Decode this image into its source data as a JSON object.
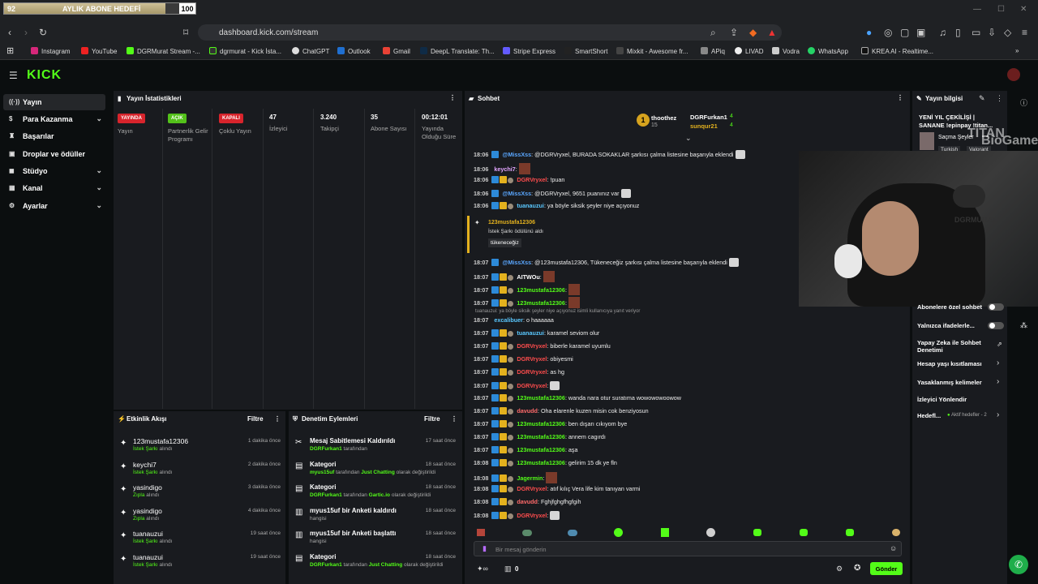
{
  "browser": {
    "goal_current": "92",
    "goal_label": "AYLIK ABONE HEDEFİ",
    "goal_total": "100",
    "goal_progress": 0.92,
    "url": "dashboard.kick.com/stream",
    "bookmarks": [
      "Instagram",
      "YouTube",
      "DGRMurat Stream -...",
      "dgrmurat - Kick İsta...",
      "ChatGPT",
      "Outlook",
      "Gmail",
      "DeepL Translate: Th...",
      "Stripe Express",
      "SmartShort",
      "Mixkit - Awesome fr...",
      "APiq",
      "LIVAD",
      "Vodra",
      "WhatsApp",
      "KREA AI - Realtime..."
    ]
  },
  "sidebar": {
    "items": [
      "Yayın",
      "Para Kazanma",
      "Başarılar",
      "Droplar ve ödüller",
      "Stüdyo",
      "Kanal",
      "Ayarlar"
    ]
  },
  "stats": {
    "title": "Yayın İstatistikleri",
    "badges": [
      {
        "badge": "YAYINDA",
        "label": "Yayın",
        "color": "#d8242c"
      },
      {
        "badge": "AÇIK",
        "label": "Partnerlik Gelir Programı",
        "color": "#53c11a"
      },
      {
        "badge": "KAPALI",
        "label": "Çoklu Yayın",
        "color": "#d8242c"
      }
    ],
    "values": [
      {
        "value": "47",
        "label": "İzleyici"
      },
      {
        "value": "3.240",
        "label": "Takipçi"
      },
      {
        "value": "35",
        "label": "Abone Sayısı"
      },
      {
        "value": "00:12:01",
        "label": "Yayında Olduğu Süre"
      }
    ]
  },
  "activity": {
    "title": "Etkinlik Akışı",
    "filter": "Filtre",
    "rows": [
      {
        "name": "123mustafa12306",
        "action": "İstek Şarkı",
        "suffix": "alındı",
        "time": "1 dakika önce"
      },
      {
        "name": "keychi7",
        "action": "İstek Şarkı",
        "suffix": "alındı",
        "time": "2 dakika önce"
      },
      {
        "name": "yasindigo",
        "action": "Zıpla",
        "suffix": "alındı",
        "time": "3 dakika önce"
      },
      {
        "name": "yasindigo",
        "action": "Zıpla",
        "suffix": "alındı",
        "time": "4 dakika önce"
      },
      {
        "name": "tuanauzui",
        "action": "İstek Şarkı",
        "suffix": "alındı",
        "time": "19 saat önce"
      },
      {
        "name": "tuanauzui",
        "action": "İstek Şarkı",
        "suffix": "alındı",
        "time": "19 saat önce"
      }
    ]
  },
  "moderation": {
    "title": "Denetim Eylemleri",
    "filter": "Filtre",
    "rows": [
      {
        "title": "Mesaj Sabitlemesi Kaldırıldı",
        "u": "DGRFurkan1",
        "rest": "tarafından",
        "g2": "",
        "rest2": "",
        "time": "17 saat önce"
      },
      {
        "title": "Kategori",
        "u": "myus15uf",
        "rest": "tarafından",
        "g2": "Just Chatting",
        "rest2": "olarak değiştirildi",
        "time": "18 saat önce"
      },
      {
        "title": "Kategori",
        "u": "DGRFurkan1",
        "rest": "tarafından",
        "g2": "Gartic.io",
        "rest2": "olarak değiştirildi",
        "time": "18 saat önce"
      },
      {
        "title": "myus15uf bir Anketi kaldırdı",
        "u": "",
        "rest": "hangisi",
        "g2": "",
        "rest2": "",
        "time": "18 saat önce"
      },
      {
        "title": "myus15uf bir Anketi başlattı",
        "u": "",
        "rest": "hangisi",
        "g2": "",
        "rest2": "",
        "time": "18 saat önce"
      },
      {
        "title": "Kategori",
        "u": "DGRFurkan1",
        "rest": "tarafından",
        "g2": "Just Chatting",
        "rest2": "olarak değiştirildi",
        "time": "18 saat önce"
      }
    ]
  },
  "chat": {
    "title": "Sohbet",
    "top1": "thoothez",
    "top1_count": "15",
    "top2": "DGRFurkan1",
    "top2_count": "4",
    "top3": "sunqur21",
    "top3_count": "4",
    "redeem_user": "123mustafa12306",
    "redeem_text": "İstek Şarkı ödülünü aldı",
    "redeem_song": "tükeneceğiz",
    "reply_note": "tuanauzui: ya böyle siksik şeyler niye açıyonuz isimli kullanıcıya yanıt veriyor",
    "placeholder": "Bir mesaj gönderin",
    "send": "Gönder",
    "points": "0",
    "messages": [
      {
        "time": "18:06",
        "user": "@MissXss",
        "color": "#5aa7ff",
        "text": ": @DGRVryxel, BURADA SOKAKLAR şarkısı çalma listesine başarıyla eklendi"
      },
      {
        "time": "18:06",
        "user": "keychi7",
        "color": "#e2a5ff",
        "text": ":"
      },
      {
        "time": "18:06",
        "user": "DGRVryxel",
        "color": "#ff4d4d",
        "text": ": !puan"
      },
      {
        "time": "18:06",
        "user": "@MissXss",
        "color": "#5aa7ff",
        "text": ": @DGRVryxel, 9651 puanınız var"
      },
      {
        "time": "18:06",
        "user": "tuanauzui",
        "color": "#5ac8ff",
        "text": ": ya böyle siksik şeyler niye açıyonuz"
      },
      {
        "time": "18:07",
        "user": "@MissXss",
        "color": "#5aa7ff",
        "text": ": @123mustafa12306, Tükeneceğiz şarkısı çalma listesine başarıyla eklendi"
      },
      {
        "time": "18:07",
        "user": "AITWOu",
        "color": "#ffffff",
        "text": ":"
      },
      {
        "time": "18:07",
        "user": "123mustafa12306",
        "color": "#53fc18",
        "text": ":"
      },
      {
        "time": "18:07",
        "user": "123mustafa12306",
        "color": "#53fc18",
        "text": ":"
      },
      {
        "time": "18:07",
        "user": "excalibuer",
        "color": "#5ac8ff",
        "text": ": o haaaaaa"
      },
      {
        "time": "18:07",
        "user": "tuanauzui",
        "color": "#5ac8ff",
        "text": ": karamel seviom olur"
      },
      {
        "time": "18:07",
        "user": "DGRVryxel",
        "color": "#ff4d4d",
        "text": ": biberle karamel uyumlu"
      },
      {
        "time": "18:07",
        "user": "DGRVryxel",
        "color": "#ff4d4d",
        "text": ": obiyesmi"
      },
      {
        "time": "18:07",
        "user": "DGRVryxel",
        "color": "#ff4d4d",
        "text": ": as hg"
      },
      {
        "time": "18:07",
        "user": "DGRVryxel",
        "color": "#ff4d4d",
        "text": ":"
      },
      {
        "time": "18:07",
        "user": "123mustafa12306",
        "color": "#53fc18",
        "text": ": wanda nara otur suratıma wowowowoowow"
      },
      {
        "time": "18:07",
        "user": "davudd",
        "color": "#ff6a6a",
        "text": ": Oha elarenle kuzen misin cok benziyosun"
      },
      {
        "time": "18:07",
        "user": "123mustafa12306",
        "color": "#53fc18",
        "text": ": ben dışarı cıkıyom bye"
      },
      {
        "time": "18:07",
        "user": "123mustafa12306",
        "color": "#53fc18",
        "text": ": annem cagırdı"
      },
      {
        "time": "18:07",
        "user": "123mustafa12306",
        "color": "#53fc18",
        "text": ": aşa"
      },
      {
        "time": "18:08",
        "user": "123mustafa12306",
        "color": "#53fc18",
        "text": ": gelirim 15 dk ye fln"
      },
      {
        "time": "18:08",
        "user": "Jagermin",
        "color": "#53fc18",
        "text": ":"
      },
      {
        "time": "18:08",
        "user": "DGRVryxel",
        "color": "#ff4d4d",
        "text": ": atıf kılıç Vera life kim tanıyan varmi"
      },
      {
        "time": "18:08",
        "user": "davudd",
        "color": "#ff6a6a",
        "text": ": Fghjfghgfhgfgih"
      },
      {
        "time": "18:08",
        "user": "DGRVryxel",
        "color": "#ff4d4d",
        "text": ":"
      }
    ]
  },
  "info": {
    "title": "Yayın bilgisi",
    "stream_title": "YENİ YIL ÇEKİLİŞİ | SANANE !epinpay !titan...",
    "category": "Saçma Şeyler",
    "tags": [
      "Turkish",
      "Valorant"
    ],
    "overlay_brand": "TITAN",
    "overlay_brand2": "BioGame",
    "settings": [
      "Abonelere özel sohbet",
      "Yalnızca ifadelerle...",
      "Yapay Zeka ile Sohbet Denetimi",
      "Hesap yaşı kısıtlaması",
      "Yasaklanmış kelimeler",
      "İzleyici Yönlendir",
      "Hedefl..."
    ],
    "goal_active": "Aktif hedefler - 2"
  }
}
